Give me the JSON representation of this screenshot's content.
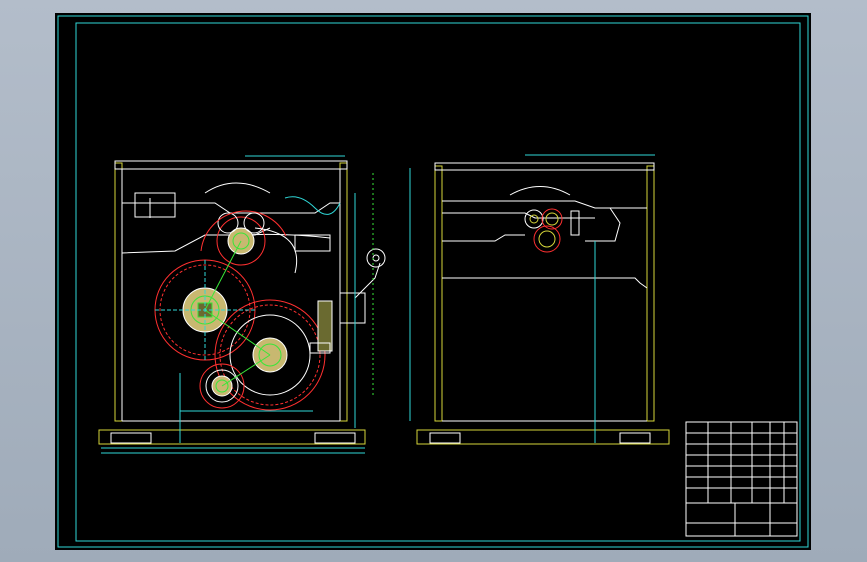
{
  "drawing": {
    "background": "#000000",
    "frame_color": "#2fd8d8",
    "wall_color": "#d6d63a",
    "gear_color": "#ff3030",
    "dim_color": "#39e639",
    "view_labels": {
      "front": "",
      "side": ""
    },
    "notes_title": "",
    "notes_lines": [],
    "title_block": {
      "title": "",
      "school": ""
    }
  }
}
